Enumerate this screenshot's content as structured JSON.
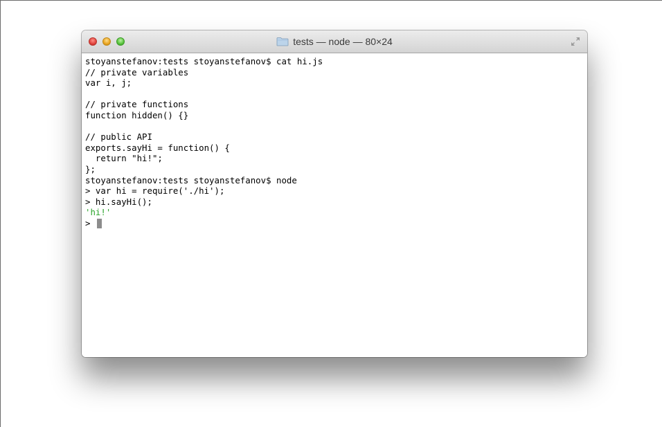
{
  "window": {
    "title": "tests — node — 80×24"
  },
  "terminal": {
    "lines": [
      "stoyanstefanov:tests stoyanstefanov$ cat hi.js",
      "// private variables",
      "var i, j;",
      "",
      "// private functions",
      "function hidden() {}",
      "",
      "// public API",
      "exports.sayHi = function() {",
      "  return \"hi!\";",
      "};",
      "stoyanstefanov:tests stoyanstefanov$ node",
      "> var hi = require('./hi');",
      "> hi.sayHi();",
      "'hi!'"
    ],
    "prompt": "> "
  },
  "colors": {
    "result_text": "#2aa52a",
    "cursor": "#8c8c8c"
  }
}
